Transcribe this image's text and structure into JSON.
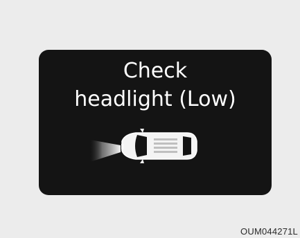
{
  "warning": {
    "line1": "Check",
    "line2": "headlight (Low)",
    "icon": "car-headlight-beam-icon"
  },
  "caption": "OUM044271L",
  "colors": {
    "background": "#ececec",
    "panel": "#141414",
    "text": "#ffffff"
  }
}
